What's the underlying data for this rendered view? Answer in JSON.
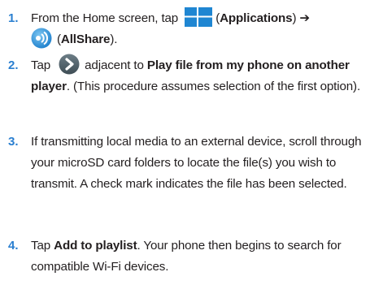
{
  "steps": [
    {
      "number": "1.",
      "line1_text_a": "From the Home screen, tap",
      "line1_text_b": "(",
      "line1_bold_b": "Applications",
      "line1_text_c": ") ➔",
      "line2_text_a": "(",
      "line2_bold_a": "AllShare",
      "line2_text_b": ")."
    },
    {
      "number": "2.",
      "text_a": "Tap",
      "text_b": "adjacent to",
      "bold_a": "Play file from my phone on another player",
      "text_c": ". (This procedure assumes selection of the first option)."
    },
    {
      "number": "3.",
      "text": "If transmitting local media to an external device, scroll through your microSD card folders to locate the file(s) you wish to transmit. A check mark indicates the file has been selected."
    },
    {
      "number": "4.",
      "text_a": "Tap",
      "bold_a": "Add to playlist",
      "text_b": ". Your phone then begins to search for compatible Wi-Fi devices."
    }
  ],
  "icons": {
    "applications": "applications-grid-icon",
    "allshare": "allshare-icon",
    "arrow": "chevron-right-icon"
  },
  "colors": {
    "step_number": "#2a7fd0",
    "text": "#231f20",
    "apps_blue": "#1f86d2",
    "allshare_blue": "#3a9de0",
    "chevron_dark": "#4a5a63"
  }
}
